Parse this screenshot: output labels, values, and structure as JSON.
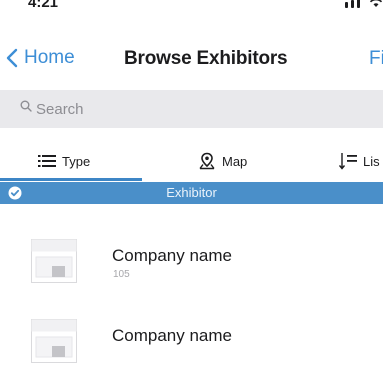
{
  "status_bar": {
    "time": "4:21"
  },
  "nav": {
    "back_label": "Home",
    "title": "Browse Exhibitors",
    "right_label": "Fi"
  },
  "search": {
    "placeholder": "Search",
    "value": ""
  },
  "tabs": [
    {
      "label": "Type",
      "icon": "list-icon",
      "active": true
    },
    {
      "label": "Map",
      "icon": "map-pin-icon",
      "active": false
    },
    {
      "label": "Lis",
      "icon": "sort-list-icon",
      "active": false
    }
  ],
  "section": {
    "title": "Exhibitor",
    "icon": "checkmark-icon"
  },
  "exhibitors": [
    {
      "name": "Company name",
      "booth": "105",
      "icon": "placeholder-logo-icon"
    },
    {
      "name": "Company name",
      "booth": "",
      "icon": "placeholder-logo-icon"
    }
  ],
  "colors": {
    "accent": "#3d8ed6",
    "section_bg": "#4a8fc9",
    "search_bg": "#e9e9ec"
  }
}
